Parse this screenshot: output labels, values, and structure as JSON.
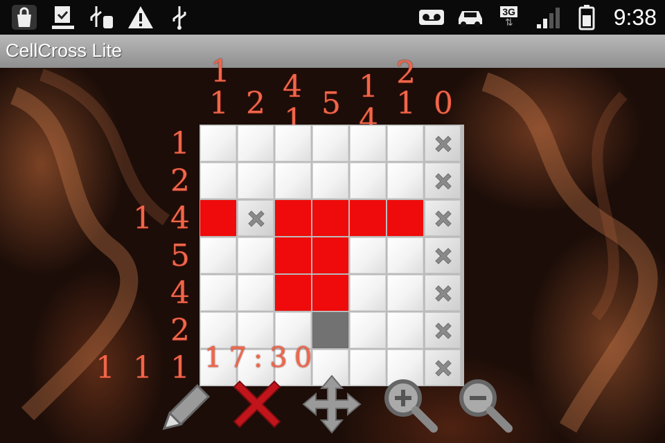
{
  "status_bar": {
    "icons": [
      "shopping-bag-icon",
      "download-done-icon",
      "usb-debug-icon",
      "warning-icon",
      "usb-icon",
      "voicemail-icon",
      "car-mode-icon",
      "network-3g-icon",
      "signal-icon",
      "battery-icon"
    ],
    "network_type": "3G",
    "time": "9:38"
  },
  "app": {
    "title": "CellCross Lite"
  },
  "puzzle": {
    "size": 7,
    "column_clues": [
      [
        "1",
        "1"
      ],
      [
        "2"
      ],
      [
        "4",
        "1"
      ],
      [
        "5"
      ],
      [
        "1",
        "4"
      ],
      [
        "2",
        "1"
      ],
      [
        "0"
      ]
    ],
    "row_clues": [
      [
        "1"
      ],
      [
        "2"
      ],
      [
        "1",
        "4"
      ],
      [
        "5"
      ],
      [
        "4"
      ],
      [
        "2"
      ],
      [
        "1",
        "1",
        "1"
      ]
    ],
    "cells": [
      [
        "empty",
        "empty",
        "empty",
        "empty",
        "empty",
        "empty",
        "crossed"
      ],
      [
        "empty",
        "empty",
        "empty",
        "empty",
        "empty",
        "empty",
        "crossed"
      ],
      [
        "filled",
        "crossed",
        "filled",
        "filled",
        "filled",
        "filled",
        "crossed"
      ],
      [
        "empty",
        "empty",
        "filled",
        "filled",
        "empty",
        "empty",
        "crossed"
      ],
      [
        "empty",
        "empty",
        "filled",
        "filled",
        "empty",
        "empty",
        "crossed"
      ],
      [
        "empty",
        "empty",
        "empty",
        "dark",
        "empty",
        "empty",
        "crossed"
      ],
      [
        "empty",
        "empty",
        "empty",
        "empty",
        "empty",
        "empty",
        "crossed"
      ]
    ],
    "timer": "17:30",
    "fill_color": "#ef0b0b"
  },
  "toolbar": [
    {
      "name": "pencil-tool",
      "icon": "pencil-icon"
    },
    {
      "name": "cross-tool",
      "icon": "x-mark-icon"
    },
    {
      "name": "move-tool",
      "icon": "move-arrows-icon"
    },
    {
      "name": "zoom-in",
      "icon": "zoom-in-icon"
    },
    {
      "name": "zoom-out",
      "icon": "zoom-out-icon"
    }
  ]
}
